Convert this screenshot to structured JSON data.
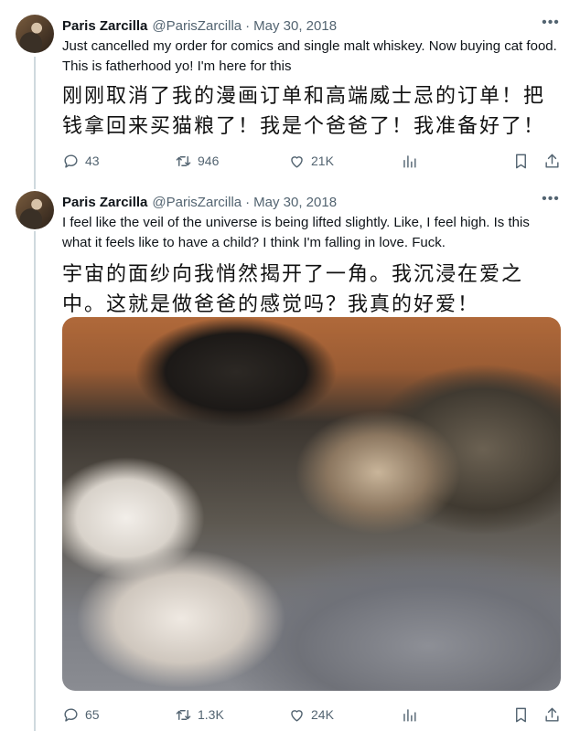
{
  "tweets": [
    {
      "author_name": "Paris Zarcilla",
      "handle": "@ParisZarcilla",
      "separator": "·",
      "date": "May 30, 2018",
      "text_en": "Just cancelled my order for comics and single malt whiskey. Now buying cat food. This is fatherhood yo! I'm here for this",
      "text_zh": "刚刚取消了我的漫画订单和高端威士忌的订单！把钱拿回来买猫粮了！我是个爸爸了！我准备好了！",
      "replies": "43",
      "retweets": "946",
      "likes": "21K"
    },
    {
      "author_name": "Paris Zarcilla",
      "handle": "@ParisZarcilla",
      "separator": "·",
      "date": "May 30, 2018",
      "text_en": "I feel like the veil of the universe is being lifted slightly. Like, I feel high. Is this what it feels like to have a child? I think I'm falling in love. Fuck.",
      "text_zh": "宇宙的面纱向我悄然揭开了一角。我沉浸在爱之中。这就是做爸爸的感觉吗？我真的好爱！",
      "replies": "65",
      "retweets": "1.3K",
      "likes": "24K"
    }
  ],
  "icons": {
    "more": "more-horizontal-icon",
    "reply": "reply-icon",
    "retweet": "retweet-icon",
    "like": "heart-icon",
    "views": "views-icon",
    "bookmark": "bookmark-icon",
    "share": "share-icon"
  },
  "colors": {
    "text": "#0f1419",
    "secondary": "#536471",
    "thread_line": "#cfd9de"
  }
}
